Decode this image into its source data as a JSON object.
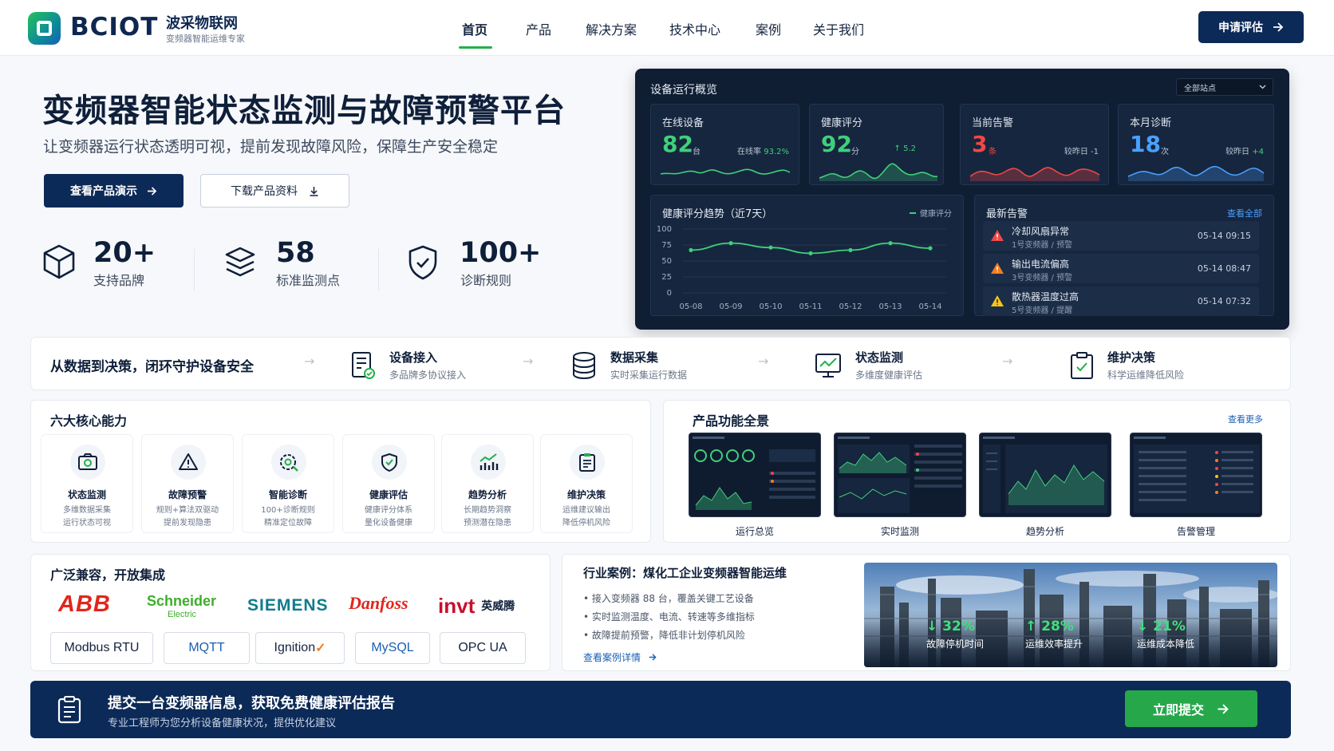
{
  "header": {
    "brand": "BCIOT",
    "brand_cn": "波采物联网",
    "brand_sub": "变频器智能运维专家",
    "nav": [
      "首页",
      "产品",
      "解决方案",
      "技术中心",
      "案例",
      "关于我们"
    ],
    "active_nav": "首页",
    "apply_button": "申请评估"
  },
  "hero": {
    "title": "变频器智能状态监测与故障预警平台",
    "subtitle": "让变频器运行状态透明可视，提前发现故障风险，保障生产安全稳定",
    "primary_button": "查看产品演示",
    "secondary_button": "下载产品资料",
    "stats": [
      {
        "value": "20+",
        "label": "支持品牌",
        "icon": "cube-icon"
      },
      {
        "value": "58",
        "label": "标准监测点",
        "icon": "layers-icon"
      },
      {
        "value": "100+",
        "label": "诊断规则",
        "icon": "shield-check-icon"
      }
    ]
  },
  "dashboard": {
    "title": "设备运行概览",
    "site_select": "全部站点",
    "kpis": [
      {
        "label": "在线设备",
        "value": "82",
        "unit": "台",
        "side_label": "在线率",
        "side_value": "93.2%",
        "color": "#3fd07a"
      },
      {
        "label": "健康评分",
        "value": "92",
        "unit": "分",
        "side_label": "↑",
        "side_value": "5.2",
        "color": "#3fd07a"
      },
      {
        "label": "当前告警",
        "value": "3",
        "unit": "条",
        "side_label": "较昨日 -1",
        "side_value": "",
        "color": "#f04747"
      },
      {
        "label": "本月诊断",
        "value": "18",
        "unit": "次",
        "side_label": "较昨日",
        "side_value": "+4",
        "color": "#4aa0ff"
      }
    ],
    "trend": {
      "title": "健康评分趋势（近7天）",
      "legend": "健康评分"
    },
    "alerts": {
      "title": "最新告警",
      "view_all": "查看全部",
      "items": [
        {
          "title": "冷却风扇异常",
          "sub": "1号变频器 / 预警",
          "time": "05-14 09:15",
          "color": "#f04747"
        },
        {
          "title": "输出电流偏高",
          "sub": "3号变频器 / 预警",
          "time": "05-14 08:47",
          "color": "#f57c1f"
        },
        {
          "title": "散热器温度过高",
          "sub": "5号变频器 / 提醒",
          "time": "05-14 07:32",
          "color": "#f5c518"
        }
      ]
    }
  },
  "chart_data": {
    "type": "line",
    "title": "健康评分趋势（近7天）",
    "x": [
      "05-08",
      "05-09",
      "05-10",
      "05-11",
      "05-12",
      "05-13",
      "05-14"
    ],
    "series": [
      {
        "name": "健康评分",
        "values": [
          67,
          78,
          71,
          62,
          67,
          78,
          70
        ]
      }
    ],
    "ylim": [
      0,
      100
    ],
    "yticks": [
      0,
      25,
      50,
      75,
      100
    ],
    "grid": true,
    "legend": "top-right"
  },
  "flow": {
    "title": "从数据到决策，闭环守护设备安全",
    "steps": [
      {
        "name": "设备接入",
        "desc": "多品牌多协议接入",
        "icon": "device-list-icon"
      },
      {
        "name": "数据采集",
        "desc": "实时采集运行数据",
        "icon": "database-icon"
      },
      {
        "name": "状态监测",
        "desc": "多维度健康评估",
        "icon": "monitor-chart-icon"
      },
      {
        "name": "维护决策",
        "desc": "科学运维降低风险",
        "icon": "clipboard-check-icon"
      }
    ]
  },
  "capabilities": {
    "title": "六大核心能力",
    "items": [
      {
        "name": "状态监测",
        "d1": "多维数据采集",
        "d2": "运行状态可视",
        "icon": "camera-monitor-icon"
      },
      {
        "name": "故障预警",
        "d1": "规则+算法双驱动",
        "d2": "提前发现隐患",
        "icon": "warning-icon"
      },
      {
        "name": "智能诊断",
        "d1": "100+诊断规则",
        "d2": "精准定位故障",
        "icon": "diagnosis-icon"
      },
      {
        "name": "健康评估",
        "d1": "健康评分体系",
        "d2": "量化设备健康",
        "icon": "shield-check-icon"
      },
      {
        "name": "趋势分析",
        "d1": "长期趋势洞察",
        "d2": "预测潜在隐患",
        "icon": "trend-bars-icon"
      },
      {
        "name": "维护决策",
        "d1": "运维建议输出",
        "d2": "降低停机风险",
        "icon": "clipboard-icon"
      }
    ]
  },
  "overview": {
    "title": "产品功能全景",
    "more": "查看更多",
    "shots": [
      "运行总览",
      "实时监测",
      "趋势分析",
      "告警管理"
    ]
  },
  "compat": {
    "title": "广泛兼容，开放集成",
    "brands": [
      "ABB",
      "Schneider",
      "Electric",
      "SIEMENS",
      "Danfoss",
      "invt",
      "英威腾"
    ],
    "protocols": [
      "Modbus RTU",
      "MQTT",
      "Ignition",
      "MySQL",
      "OPC UA"
    ]
  },
  "case": {
    "title": "行业案例：煤化工企业变频器智能运维",
    "bullets": [
      "接入变频器 88 台，覆盖关键工艺设备",
      "实时监测温度、电流、转速等多维指标",
      "故障提前预警，降低非计划停机风险"
    ],
    "link": "查看案例详情",
    "metrics": [
      {
        "value": "32%",
        "arrow": "↓",
        "label": "故障停机时间"
      },
      {
        "value": "28%",
        "arrow": "↑",
        "label": "运维效率提升"
      },
      {
        "value": "21%",
        "arrow": "↓",
        "label": "运维成本降低"
      }
    ]
  },
  "cta": {
    "title": "提交一台变频器信息，获取免费健康评估报告",
    "subtitle": "专业工程师为您分析设备健康状况，提供优化建议",
    "button": "立即提交"
  }
}
